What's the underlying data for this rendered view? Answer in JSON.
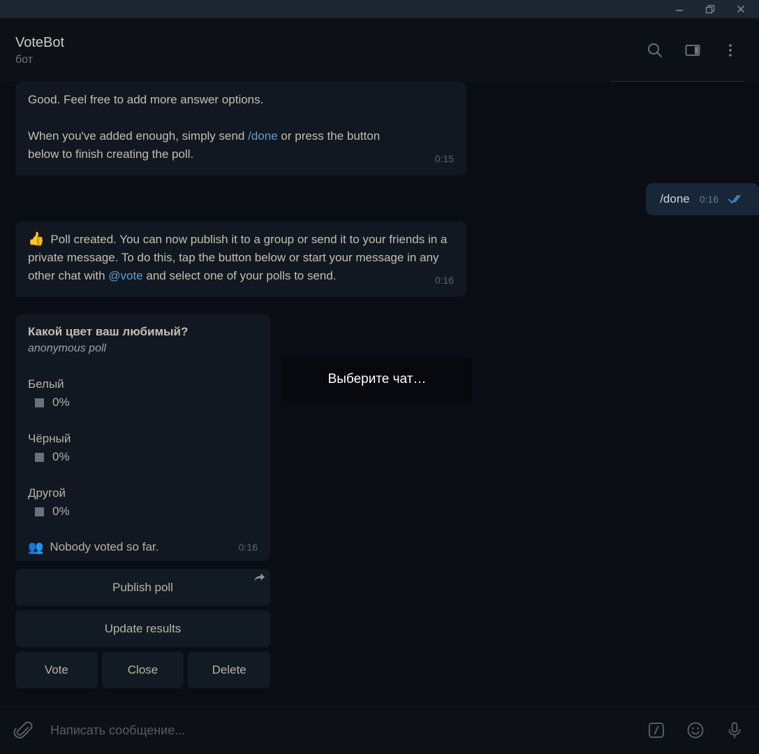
{
  "window": {
    "controls": [
      {
        "name": "minimize",
        "label": "Minimize"
      },
      {
        "name": "maximize",
        "label": "Restore"
      },
      {
        "name": "close",
        "label": "Close"
      }
    ]
  },
  "header": {
    "title": "VoteBot",
    "subtitle": "бот",
    "actions": [
      {
        "name": "search",
        "label": "Search"
      },
      {
        "name": "panel",
        "label": "Toggle info panel"
      },
      {
        "name": "menu",
        "label": "More"
      }
    ]
  },
  "messages": {
    "bot_1": {
      "line1": "Good. Feel free to add more answer options.",
      "line2_a": "When you've added enough, simply send ",
      "line2_link": "/done",
      "line2_b": " or press the button",
      "line3": "below to finish creating the poll.",
      "time": "0:15"
    },
    "user_1": {
      "text": "/done",
      "time": "0:16",
      "status": "read"
    },
    "bot_2": {
      "emoji": "👍",
      "text_a": " Poll created. You can now publish it to a group or send it to your friends in a private message. To do this, tap the button below or start your message in any other chat with ",
      "link": "@vote",
      "text_b": " and select one of your polls to send.",
      "time": "0:16"
    }
  },
  "poll": {
    "question": "Какой цвет ваш любимый?",
    "type": "anonymous poll",
    "options": [
      {
        "label": "Белый",
        "percent": "0%"
      },
      {
        "label": "Чёрный",
        "percent": "0%"
      },
      {
        "label": "Другой",
        "percent": "0%"
      }
    ],
    "footer_emoji": "👥",
    "footer_text": "Nobody voted so far.",
    "time": "0:16"
  },
  "keyboard": {
    "rows": [
      [
        {
          "label": "Publish poll",
          "icon": "share-arrow-icon"
        }
      ],
      [
        {
          "label": "Update results"
        }
      ],
      [
        {
          "label": "Vote"
        },
        {
          "label": "Close"
        },
        {
          "label": "Delete"
        }
      ]
    ]
  },
  "tooltip": {
    "text": "Выберите чат…"
  },
  "composer": {
    "attach_label": "Attach file",
    "placeholder": "Написать сообщение...",
    "value": "",
    "actions": [
      {
        "name": "command",
        "label": "/"
      },
      {
        "name": "emoji",
        "label": "Emoji"
      },
      {
        "name": "voice",
        "label": "Record voice"
      }
    ]
  },
  "colors": {
    "app_background": "#0a0d14",
    "titlebar": "#1c2733",
    "header": "#0d1117",
    "bubble_in": "#111821",
    "bubble_out": "#182738",
    "accent_link": "#5d9fd4",
    "text_primary": "#c7bfae",
    "text_muted": "#5c6670",
    "check_blue": "#4b8fc7"
  }
}
